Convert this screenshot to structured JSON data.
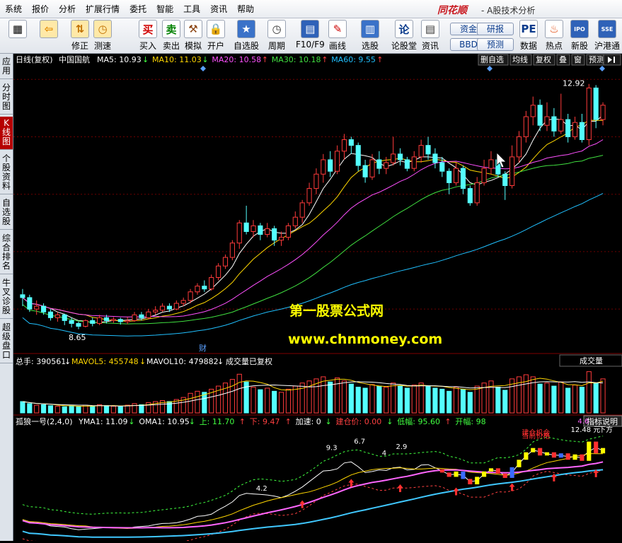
{
  "menu": [
    "系统",
    "报价",
    "分析",
    "扩展行情",
    "委托",
    "智能",
    "工具",
    "资讯",
    "帮助"
  ],
  "brand": "同花顺",
  "window_subtitle": "- A股技术分析",
  "toolbar": [
    {
      "label": "",
      "icon": "grid-icon"
    },
    {
      "label": "",
      "icon": "back-arrow-icon"
    },
    {
      "label": "修正",
      "icon": "up-down-arrows-icon"
    },
    {
      "label": "测速",
      "icon": "clock-icon"
    },
    {
      "label": "买入",
      "icon": "buy-icon",
      "glyph": "买"
    },
    {
      "label": "卖出",
      "icon": "sell-icon",
      "glyph": "卖"
    },
    {
      "label": "模拟",
      "icon": "hammer-icon"
    },
    {
      "label": "开户",
      "icon": "lock-icon"
    },
    {
      "label": "自选股",
      "icon": "star-folder-icon"
    },
    {
      "label": "周期",
      "icon": "clock-icon"
    },
    {
      "label": "F10/F9",
      "icon": "report-icon"
    },
    {
      "label": "画线",
      "icon": "pencil-icon"
    },
    {
      "label": "选股",
      "icon": "chart-icon"
    },
    {
      "label": "论股堂",
      "icon": "forum-icon",
      "glyph": "论"
    },
    {
      "label": "资讯",
      "icon": "document-icon"
    },
    {
      "label": "数据",
      "icon": "pe-icon",
      "glyph": "PE"
    },
    {
      "label": "热点",
      "icon": "hot-icon"
    },
    {
      "label": "新股",
      "icon": "ipo-icon",
      "glyph": "IPO"
    },
    {
      "label": "沪港通",
      "icon": "hk-icon",
      "glyph": "SSE"
    }
  ],
  "pills": [
    "资金",
    "BBD",
    "研报",
    "预测"
  ],
  "sidebar_tabs": [
    "应用",
    "分时图",
    "K线图",
    "个股资料",
    "自选股",
    "综合排名",
    "牛叉诊股",
    "超级盘口"
  ],
  "main_header": {
    "period": "日线(复权)",
    "stock": "中国国航",
    "ma": [
      {
        "label": "MA5: 10.93",
        "arrow": "↓",
        "color": "#ffffff"
      },
      {
        "label": "MA10: 11.03",
        "arrow": "↓",
        "color": "#ffd700"
      },
      {
        "label": "MA20: 10.58",
        "arrow": "↑",
        "color": "#ff50ff"
      },
      {
        "label": "MA30: 10.18",
        "arrow": "↑",
        "color": "#40e040"
      },
      {
        "label": "MA60: 9.55",
        "arrow": "↑",
        "color": "#20c0ff"
      }
    ],
    "buttons": [
      "删自选",
      "均线",
      "复权",
      "叠",
      "窗",
      "预测"
    ]
  },
  "price_labels": {
    "high": "12.92",
    "low": "8.65"
  },
  "watermark": {
    "line1": "第一股票公式网",
    "line2": "www.chnmoney.com"
  },
  "event_marker": "财",
  "volume_header": {
    "total": "总手: 390561",
    "total_arrow": "↓",
    "mavol5": "MAVOL5: 455748",
    "mavol5_arrow": "↓",
    "mavol10": "MAVOL10: 479882",
    "mavol10_arrow": "↓",
    "note": "成交量已复权",
    "dropdown": "成交量"
  },
  "indicator_header": {
    "name": "孤狼一号(2,4,0)",
    "yma": "YMA1: 11.09",
    "yma_arrow": "↓",
    "oma": "OMA1: 10.95",
    "oma_arrow": "↓",
    "up": "上: 11.70",
    "up_arrow": "↑",
    "down": "下: 9.47",
    "down_arrow": "↑",
    "accel": "加速: 0",
    "accel_arrow": "↓",
    "cost": "建仓价: 0.00",
    "cost_arrow": "↓",
    "low": "低幅: 95.60",
    "low_arrow": "↑",
    "open": "开幅: 98",
    "explain_button": "指标说明"
  },
  "indicator_labels": [
    "6.7",
    "9.3",
    "4",
    "2.9",
    "4.2",
    "4.6",
    "12.48 元",
    "下方",
    "建仓机会",
    "当前价格"
  ],
  "colors": {
    "up_candle": "#ff3b3b",
    "down_candle": "#54ffff",
    "grid": "#800000",
    "text_header": "#ffffff",
    "watermark": "#ffff00",
    "brand": "#c8161d"
  },
  "chart_data": {
    "type": "candlestick",
    "title": "",
    "ylim": [
      8.3,
      13.2
    ],
    "ohlc": [
      [
        9.25,
        9.2,
        9.35,
        9.05
      ],
      [
        9.2,
        9.0,
        9.25,
        8.95
      ],
      [
        9.0,
        9.05,
        9.15,
        8.9
      ],
      [
        9.05,
        8.95,
        9.1,
        8.9
      ],
      [
        8.95,
        8.85,
        9.0,
        8.8
      ],
      [
        8.85,
        8.9,
        8.95,
        8.78
      ],
      [
        8.9,
        8.8,
        8.92,
        8.72
      ],
      [
        8.8,
        8.75,
        8.85,
        8.68
      ],
      [
        8.75,
        8.7,
        8.78,
        8.65
      ],
      [
        8.7,
        8.8,
        8.82,
        8.68
      ],
      [
        8.8,
        8.75,
        8.85,
        8.7
      ],
      [
        8.75,
        8.85,
        8.9,
        8.72
      ],
      [
        8.85,
        8.8,
        8.9,
        8.75
      ],
      [
        8.8,
        8.82,
        8.86,
        8.76
      ],
      [
        8.82,
        8.78,
        8.85,
        8.73
      ],
      [
        8.78,
        8.8,
        8.86,
        8.74
      ],
      [
        8.8,
        8.9,
        8.95,
        8.78
      ],
      [
        8.9,
        8.85,
        8.95,
        8.8
      ],
      [
        8.85,
        8.95,
        9.0,
        8.82
      ],
      [
        8.95,
        8.98,
        9.05,
        8.9
      ],
      [
        8.98,
        9.05,
        9.1,
        8.95
      ],
      [
        9.05,
        9.0,
        9.1,
        8.95
      ],
      [
        9.0,
        9.1,
        9.15,
        8.98
      ],
      [
        9.1,
        9.15,
        9.2,
        9.05
      ],
      [
        9.15,
        9.3,
        9.35,
        9.1
      ],
      [
        9.3,
        9.4,
        9.45,
        9.25
      ],
      [
        9.4,
        9.35,
        9.5,
        9.3
      ],
      [
        9.35,
        9.55,
        9.6,
        9.32
      ],
      [
        9.55,
        9.75,
        9.8,
        9.5
      ],
      [
        9.75,
        9.9,
        9.95,
        9.7
      ],
      [
        9.9,
        10.15,
        10.2,
        9.85
      ],
      [
        10.15,
        10.5,
        10.55,
        10.05
      ],
      [
        10.5,
        10.35,
        10.8,
        10.3
      ],
      [
        10.35,
        10.45,
        10.55,
        10.25
      ],
      [
        10.45,
        10.3,
        10.5,
        10.2
      ],
      [
        10.3,
        10.4,
        10.5,
        10.25
      ],
      [
        10.4,
        10.2,
        10.45,
        10.1
      ],
      [
        10.2,
        10.25,
        10.35,
        10.1
      ],
      [
        10.25,
        10.45,
        10.5,
        10.2
      ],
      [
        10.45,
        10.6,
        10.7,
        10.4
      ],
      [
        10.6,
        10.85,
        10.9,
        10.5
      ],
      [
        10.85,
        11.1,
        11.2,
        10.8
      ],
      [
        11.1,
        11.35,
        11.45,
        11.0
      ],
      [
        11.35,
        11.6,
        11.7,
        11.2
      ],
      [
        11.6,
        11.4,
        11.75,
        11.3
      ],
      [
        11.4,
        11.75,
        11.85,
        11.35
      ],
      [
        11.75,
        11.95,
        12.05,
        11.6
      ],
      [
        11.95,
        11.85,
        12.0,
        11.7
      ],
      [
        11.85,
        11.5,
        11.9,
        11.4
      ],
      [
        11.5,
        11.3,
        11.6,
        11.2
      ],
      [
        11.3,
        11.6,
        11.7,
        11.25
      ],
      [
        11.6,
        11.45,
        11.75,
        11.35
      ],
      [
        11.45,
        11.55,
        11.65,
        11.35
      ],
      [
        11.55,
        11.7,
        12.0,
        11.5
      ],
      [
        11.7,
        11.6,
        11.8,
        11.5
      ],
      [
        11.6,
        11.45,
        11.65,
        11.4
      ],
      [
        11.45,
        11.65,
        11.75,
        11.4
      ],
      [
        11.65,
        11.85,
        11.95,
        11.55
      ],
      [
        11.85,
        11.7,
        12.0,
        11.6
      ],
      [
        11.7,
        11.55,
        11.8,
        11.45
      ],
      [
        11.55,
        11.4,
        11.65,
        11.3
      ],
      [
        11.4,
        11.2,
        11.45,
        11.0
      ],
      [
        11.2,
        11.45,
        11.55,
        11.15
      ],
      [
        11.45,
        11.1,
        11.5,
        11.0
      ],
      [
        11.1,
        10.85,
        11.15,
        10.8
      ],
      [
        10.85,
        11.2,
        11.3,
        10.8
      ],
      [
        11.2,
        11.45,
        11.6,
        11.15
      ],
      [
        11.45,
        11.6,
        11.75,
        11.35
      ],
      [
        11.6,
        11.35,
        11.65,
        11.3
      ],
      [
        11.35,
        11.15,
        11.4,
        10.9
      ],
      [
        11.15,
        11.65,
        11.85,
        11.1
      ],
      [
        11.65,
        12.0,
        12.1,
        11.55
      ],
      [
        12.0,
        12.35,
        12.45,
        11.9
      ],
      [
        12.35,
        12.55,
        12.7,
        12.2
      ],
      [
        12.55,
        12.2,
        12.65,
        12.1
      ],
      [
        12.2,
        12.35,
        12.6,
        12.1
      ],
      [
        12.35,
        12.1,
        12.5,
        12.0
      ],
      [
        12.1,
        12.3,
        12.75,
        12.05
      ],
      [
        12.3,
        12.0,
        12.4,
        11.9
      ],
      [
        12.0,
        12.25,
        12.35,
        11.95
      ],
      [
        12.25,
        11.95,
        12.4,
        11.9
      ],
      [
        11.95,
        12.85,
        12.92,
        11.85
      ],
      [
        12.85,
        12.3,
        12.9,
        12.15
      ],
      [
        12.3,
        12.55,
        12.6,
        12.2
      ]
    ],
    "volume": [
      22,
      18,
      15,
      16,
      14,
      13,
      12,
      14,
      12,
      15,
      13,
      16,
      14,
      13,
      12,
      15,
      18,
      16,
      20,
      22,
      24,
      22,
      26,
      30,
      38,
      42,
      40,
      46,
      52,
      58,
      65,
      75,
      60,
      50,
      45,
      48,
      42,
      40,
      46,
      52,
      58,
      62,
      66,
      70,
      60,
      68,
      62,
      56,
      50,
      48,
      55,
      52,
      50,
      58,
      52,
      48,
      54,
      58,
      52,
      48,
      46,
      42,
      50,
      46,
      40,
      52,
      58,
      62,
      50,
      44,
      66,
      70,
      74,
      70,
      56,
      58,
      52,
      60,
      48,
      54,
      50,
      80,
      58,
      66
    ]
  }
}
